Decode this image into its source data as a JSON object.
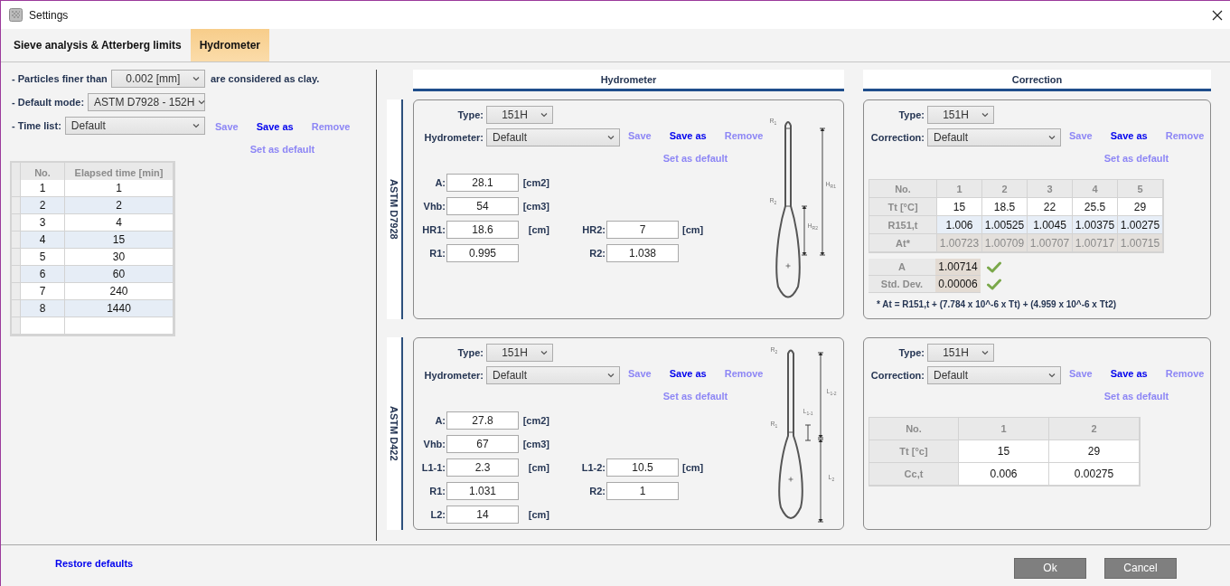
{
  "window": {
    "title": "Settings"
  },
  "tabs": [
    {
      "label": "Sieve analysis & Atterberg limits",
      "selected": false
    },
    {
      "label": "Hydrometer",
      "selected": true
    }
  ],
  "general": {
    "clay": {
      "label": "- Particles finer than",
      "value": "0.002 [mm]",
      "suffix": "are considered as clay."
    },
    "default_mode": {
      "label": "- Default mode:",
      "value": "ASTM D7928 - 152H"
    },
    "time_list": {
      "label": "- Time list:",
      "value": "Default"
    },
    "time_list_actions": [
      {
        "label": "Save",
        "disabled": true
      },
      {
        "label": "Save as",
        "disabled": false
      },
      {
        "label": "Remove",
        "disabled": true
      },
      {
        "label": "Set as default",
        "disabled": true
      }
    ],
    "time_table": {
      "columns": [
        "No.",
        "Elapsed time [min]"
      ],
      "rows": [
        [
          "1",
          "1"
        ],
        [
          "2",
          "2"
        ],
        [
          "3",
          "4"
        ],
        [
          "4",
          "15"
        ],
        [
          "5",
          "30"
        ],
        [
          "6",
          "60"
        ],
        [
          "7",
          "240"
        ],
        [
          "8",
          "1440"
        ]
      ]
    }
  },
  "column_headers": [
    "Hydrometer",
    "Correction"
  ],
  "methods": [
    {
      "label": "ASTM D7928",
      "hydrometer": {
        "type": {
          "label": "Type:",
          "value": "151H"
        },
        "selector": {
          "label": "Hydrometer:",
          "value": "Default"
        },
        "actions": [
          {
            "label": "Save",
            "disabled": true
          },
          {
            "label": "Save as",
            "disabled": false
          },
          {
            "label": "Remove",
            "disabled": true
          },
          {
            "label": "Set as default",
            "disabled": true
          }
        ],
        "field_rows": [
          [
            {
              "label": "A:",
              "value": "28.1",
              "unit": "[cm2]"
            }
          ],
          [
            {
              "label": "Vhb:",
              "value": "54",
              "unit": "[cm3]"
            }
          ],
          [
            {
              "label": "HR1:",
              "value": "18.6",
              "unit": "[cm]"
            },
            {
              "label": "HR2:",
              "value": "7",
              "unit": "[cm]"
            }
          ],
          [
            {
              "label": "R1:",
              "value": "0.995"
            },
            {
              "label": "R2:",
              "value": "1.038"
            }
          ]
        ],
        "diagram": {
          "kind": "d7928",
          "labels": [
            "R$_{1}$",
            "R$_{2}$",
            "H$_{R1}$",
            "H$_{R2}$"
          ]
        }
      },
      "correction": {
        "type": {
          "label": "Type:",
          "value": "151H"
        },
        "selector": {
          "label": "Correction:",
          "value": "Default"
        },
        "actions": [
          {
            "label": "Save",
            "disabled": true
          },
          {
            "label": "Save as",
            "disabled": false
          },
          {
            "label": "Remove",
            "disabled": true
          },
          {
            "label": "Set as default",
            "disabled": true
          }
        ],
        "table": {
          "rows": [
            {
              "kind": "header",
              "label": "No.",
              "cells": [
                "1",
                "2",
                "3",
                "4",
                "5"
              ]
            },
            {
              "kind": "input",
              "label": "Tt [°C]",
              "cells": [
                "15",
                "18.5",
                "22",
                "25.5",
                "29"
              ]
            },
            {
              "kind": "computed",
              "label": "R151,t",
              "cells": [
                "1.006",
                "1.00525",
                "1.0045",
                "1.00375",
                "1.00275"
              ]
            },
            {
              "kind": "derived",
              "label": "At*",
              "cells": [
                "1.00723",
                "1.00709",
                "1.00707",
                "1.00717",
                "1.00715"
              ]
            }
          ]
        },
        "summary": [
          {
            "label": "A",
            "value": "1.00714",
            "valid": true
          },
          {
            "label": "Std. Dev.",
            "value": "0.00006",
            "valid": true
          }
        ],
        "footnote": "* At = R151,t + (7.784 x 10^-6 x Tt) + (4.959 x 10^-6 x Tt2)"
      }
    },
    {
      "label": "ASTM D422",
      "hydrometer": {
        "type": {
          "label": "Type:",
          "value": "151H"
        },
        "selector": {
          "label": "Hydrometer:",
          "value": "Default"
        },
        "actions": [
          {
            "label": "Save",
            "disabled": true
          },
          {
            "label": "Save as",
            "disabled": false
          },
          {
            "label": "Remove",
            "disabled": true
          },
          {
            "label": "Set as default",
            "disabled": true
          }
        ],
        "field_rows": [
          [
            {
              "label": "A:",
              "value": "27.8",
              "unit": "[cm2]"
            }
          ],
          [
            {
              "label": "Vhb:",
              "value": "67",
              "unit": "[cm3]"
            }
          ],
          [
            {
              "label": "L1-1:",
              "value": "2.3",
              "unit": "[cm]"
            },
            {
              "label": "L1-2:",
              "value": "10.5",
              "unit": "[cm]"
            }
          ],
          [
            {
              "label": "R1:",
              "value": "1.031"
            },
            {
              "label": "R2:",
              "value": "1"
            }
          ],
          [
            {
              "label": "L2:",
              "value": "14",
              "unit": "[cm]"
            }
          ]
        ],
        "diagram": {
          "kind": "d422",
          "labels": [
            "R$_{2}$",
            "R$_{1}$",
            "L$_{1-1}$",
            "L$_{1-2}$",
            "L$_{2}$"
          ]
        }
      },
      "correction": {
        "type": {
          "label": "Type:",
          "value": "151H"
        },
        "selector": {
          "label": "Correction:",
          "value": "Default"
        },
        "actions": [
          {
            "label": "Save",
            "disabled": true
          },
          {
            "label": "Save as",
            "disabled": false
          },
          {
            "label": "Remove",
            "disabled": true
          },
          {
            "label": "Set as default",
            "disabled": true
          }
        ],
        "table": {
          "rows": [
            {
              "kind": "header",
              "label": "No.",
              "cells": [
                "1",
                "2"
              ]
            },
            {
              "kind": "input",
              "label": "Tt [°c]",
              "cells": [
                "15",
                "29"
              ]
            },
            {
              "kind": "input",
              "label": "Cc,t",
              "cells": [
                "0.006",
                "0.00275"
              ]
            }
          ]
        }
      }
    }
  ],
  "footer": {
    "restore": "Restore defaults",
    "buttons": [
      "Ok",
      "Cancel"
    ]
  }
}
